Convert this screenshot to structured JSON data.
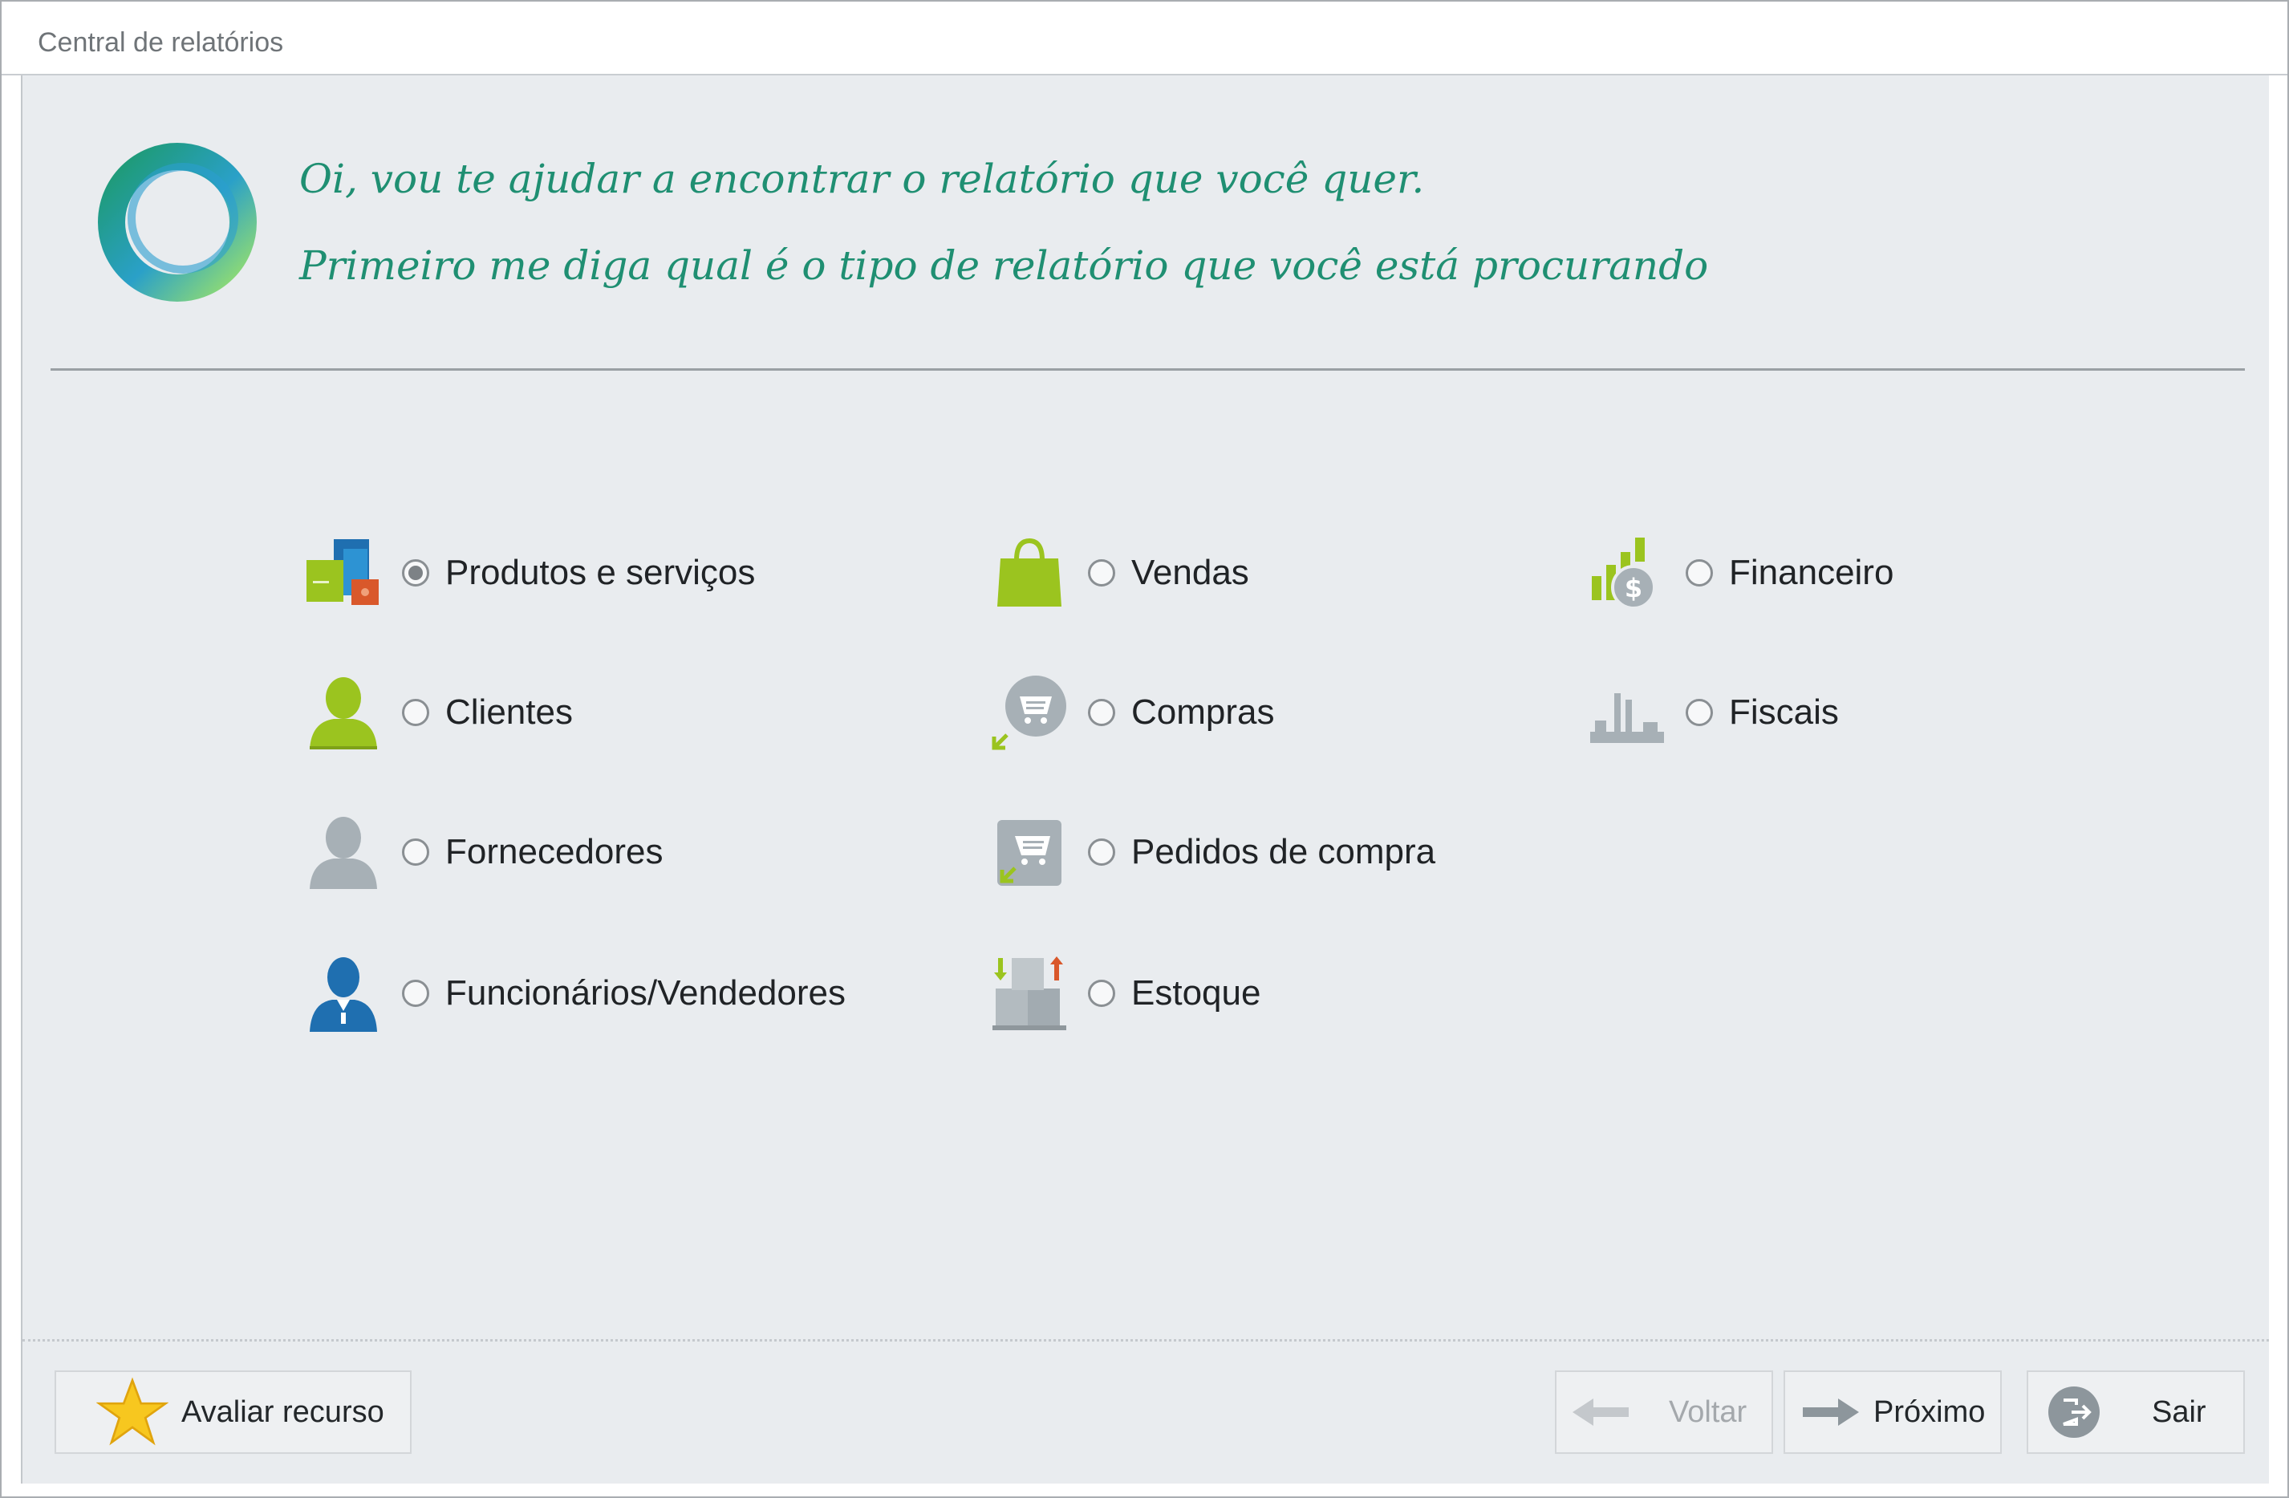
{
  "window": {
    "title": "Central de relatórios"
  },
  "assistant": {
    "line1": "Oi, vou te ajudar a encontrar o relatório que você quer.",
    "line2": "Primeiro me diga qual é o tipo de relatório que você está procurando"
  },
  "options": {
    "produtos": {
      "label": "Produtos e serviços",
      "selected": true,
      "icon": "products-icon"
    },
    "clientes": {
      "label": "Clientes",
      "selected": false,
      "icon": "client-person-icon"
    },
    "fornecedores": {
      "label": "Fornecedores",
      "selected": false,
      "icon": "supplier-person-icon"
    },
    "funcionarios": {
      "label": "Funcionários/Vendedores",
      "selected": false,
      "icon": "employee-icon"
    },
    "vendas": {
      "label": "Vendas",
      "selected": false,
      "icon": "shopping-bag-icon"
    },
    "compras": {
      "label": "Compras",
      "selected": false,
      "icon": "cart-circle-icon"
    },
    "pedidos": {
      "label": "Pedidos de compra",
      "selected": false,
      "icon": "cart-order-icon"
    },
    "estoque": {
      "label": "Estoque",
      "selected": false,
      "icon": "stock-boxes-icon"
    },
    "financeiro": {
      "label": "Financeiro",
      "selected": false,
      "icon": "finance-coin-icon"
    },
    "fiscais": {
      "label": "Fiscais",
      "selected": false,
      "icon": "tax-bars-icon"
    }
  },
  "footer": {
    "rate_label": "Avaliar recurso",
    "back_label": "Voltar",
    "next_label": "Próximo",
    "exit_label": "Sair"
  },
  "colors": {
    "accent_green": "#1f8f72",
    "lime": "#9bc41f",
    "blue": "#1f6fb0",
    "gray_icon": "#a7b0b6"
  }
}
